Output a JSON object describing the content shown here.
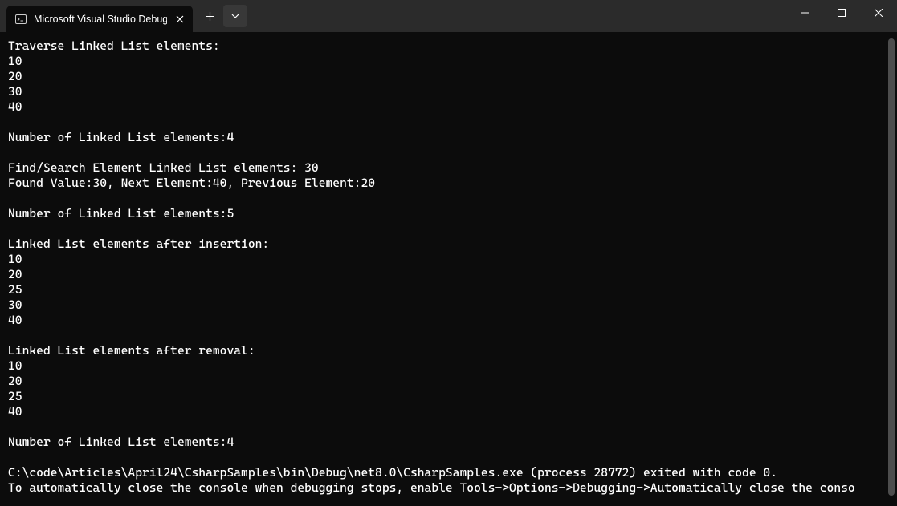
{
  "tab": {
    "title": "Microsoft Visual Studio Debug"
  },
  "terminal": {
    "lines": [
      "Traverse Linked List elements:",
      "10",
      "20",
      "30",
      "40",
      "",
      "Number of Linked List elements:4",
      "",
      "Find/Search Element Linked List elements: 30",
      "Found Value:30, Next Element:40, Previous Element:20",
      "",
      "Number of Linked List elements:5",
      "",
      "Linked List elements after insertion:",
      "10",
      "20",
      "25",
      "30",
      "40",
      "",
      "Linked List elements after removal:",
      "10",
      "20",
      "25",
      "40",
      "",
      "Number of Linked List elements:4",
      "",
      "C:\\code\\Articles\\April24\\CsharpSamples\\bin\\Debug\\net8.0\\CsharpSamples.exe (process 28772) exited with code 0.",
      "To automatically close the console when debugging stops, enable Tools->Options->Debugging->Automatically close the conso"
    ]
  }
}
